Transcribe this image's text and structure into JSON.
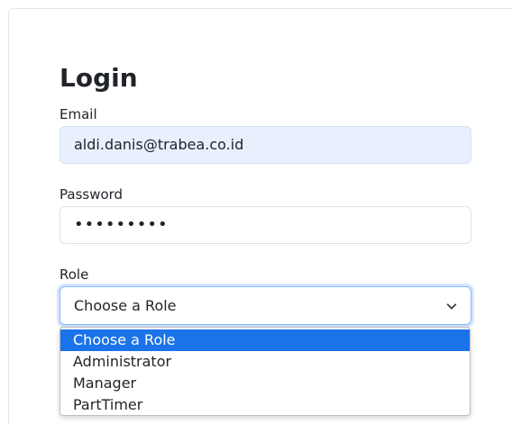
{
  "form": {
    "title": "Login",
    "email": {
      "label": "Email",
      "value": "aldi.danis@trabea.co.id"
    },
    "password": {
      "label": "Password",
      "value": "•••••••••"
    },
    "role": {
      "label": "Role",
      "selected": "Choose a Role",
      "options": [
        "Choose a Role",
        "Administrator",
        "Manager",
        "PartTimer"
      ],
      "highlighted_index": 0
    }
  },
  "colors": {
    "accent": "#1a73e8",
    "autofill_bg": "#e8f0fe",
    "focus_border": "#86b7fe"
  },
  "icons": {
    "select_arrow": "chevron-down-icon"
  }
}
